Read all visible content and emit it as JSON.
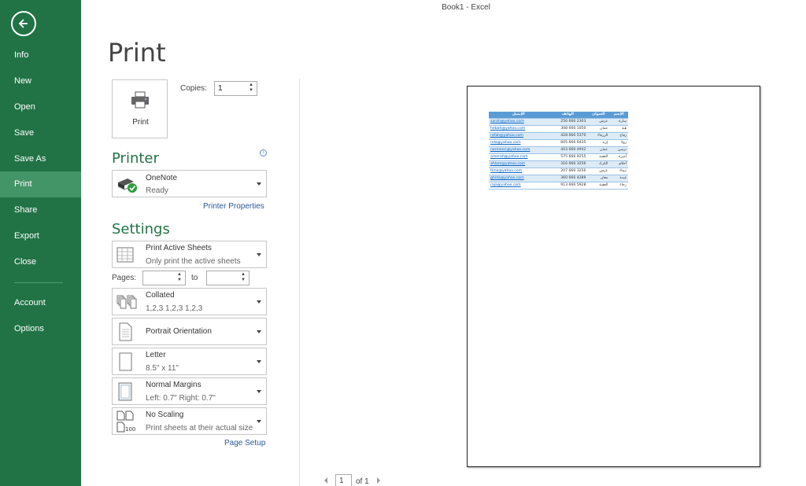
{
  "window": {
    "title": "Book1 - Excel"
  },
  "sidebar": {
    "items": [
      {
        "label": "Info"
      },
      {
        "label": "New"
      },
      {
        "label": "Open"
      },
      {
        "label": "Save"
      },
      {
        "label": "Save As"
      },
      {
        "label": "Print"
      },
      {
        "label": "Share"
      },
      {
        "label": "Export"
      },
      {
        "label": "Close"
      },
      {
        "label": "Account"
      },
      {
        "label": "Options"
      }
    ],
    "active": "Print",
    "accent": "#217346"
  },
  "print": {
    "title": "Print",
    "button_label": "Print",
    "copies_label": "Copies:",
    "copies_value": "1"
  },
  "printer": {
    "section_title": "Printer",
    "name": "OneNote",
    "status": "Ready",
    "properties_link": "Printer Properties"
  },
  "settings": {
    "section_title": "Settings",
    "what": {
      "main": "Print Active Sheets",
      "sub": "Only print the active sheets"
    },
    "pages_label": "Pages:",
    "to_label": "to",
    "collation": {
      "main": "Collated",
      "sub": "1,2,3    1,2,3    1,2,3"
    },
    "orientation": {
      "main": "Portrait Orientation"
    },
    "paper": {
      "main": "Letter",
      "sub": "8.5\" x 11\""
    },
    "margins": {
      "main": "Normal Margins",
      "sub": "Left:  0.7\"    Right:  0.7\""
    },
    "scaling": {
      "main": "No Scaling",
      "sub": "Print sheets at their actual size",
      "icon_text": "100"
    },
    "page_setup_link": "Page Setup"
  },
  "preview": {
    "headers": [
      "الإسم",
      "العنوان",
      "الهاتف",
      "الإيميل"
    ],
    "rows": [
      [
        "سارة",
        "عرش",
        "256 666 2303",
        "sarah@yahoo.com"
      ],
      [
        "هبة",
        "عمان",
        "308 666 1050",
        "hebah@yahoo.com"
      ],
      [
        "رفاح",
        "الزرقاء",
        "428 666 5370",
        "rafah@yahoo.com"
      ],
      [
        "رولا",
        "إربد",
        "605 666 6435",
        "rola@yahoo.com"
      ],
      [
        "نرمين",
        "عمان",
        "443 666 4942",
        "nermeen@yahoo.com"
      ],
      [
        "أميرة",
        "العقبة",
        "575 666 9255",
        "amerah@yahoo.com"
      ],
      [
        "أحلام",
        "الكرك",
        "316 666 3256",
        "ahlam@yahoo.com"
      ],
      [
        "تيماء",
        "عرش",
        "207 666 3256",
        "tima@yahoo.com"
      ],
      [
        "غيدة",
        "معان",
        "360 666 4289",
        "ghida@yahoo.com"
      ],
      [
        "رجاء",
        "العقبة",
        "913 666 5928",
        "raja@yahoo.com"
      ]
    ],
    "page_current": "1",
    "page_total": "of 1"
  }
}
